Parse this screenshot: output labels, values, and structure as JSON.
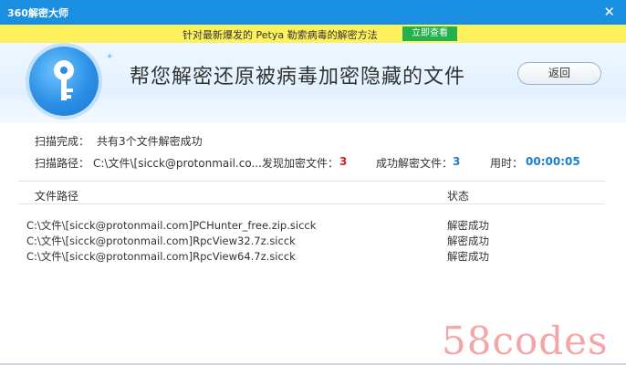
{
  "window": {
    "title": "360解密大师",
    "close_glyph": "✕"
  },
  "banner": {
    "message": "针对最新爆发的 Petya 勒索病毒的解密方法",
    "button_label": "立即查看"
  },
  "hero": {
    "headline": "帮您解密还原被病毒加密隐藏的文件",
    "back_label": "返回",
    "sparkle": "✦"
  },
  "scan": {
    "complete_label": "扫描完成：",
    "complete_value": "共有3个文件解密成功",
    "path_label": "扫描路径：",
    "path_value": "C:\\文件\\[sicck@protonmail.co...",
    "found_label": "发现加密文件：",
    "found_value": "3",
    "success_label": "成功解密文件：",
    "success_value": "3",
    "time_label": "用时：",
    "time_value": "00:00:05"
  },
  "table": {
    "headers": {
      "path": "文件路径",
      "status": "状态"
    },
    "rows": [
      {
        "path": "C:\\文件\\[sicck@protonmail.com]PCHunter_free.zip.sicck",
        "status": "解密成功"
      },
      {
        "path": "C:\\文件\\[sicck@protonmail.com]RpcView32.7z.sicck",
        "status": "解密成功"
      },
      {
        "path": "C:\\文件\\[sicck@protonmail.com]RpcView64.7z.sicck",
        "status": "解密成功"
      }
    ]
  },
  "watermark": "58codes",
  "colors": {
    "titlebar": "#1a8ee0",
    "banner": "#fef15e",
    "banner_button": "#22b14c",
    "red_count": "#d32020",
    "blue_value": "#1a7ed0"
  },
  "icons": {
    "logo": "key-icon",
    "close": "close-icon"
  }
}
